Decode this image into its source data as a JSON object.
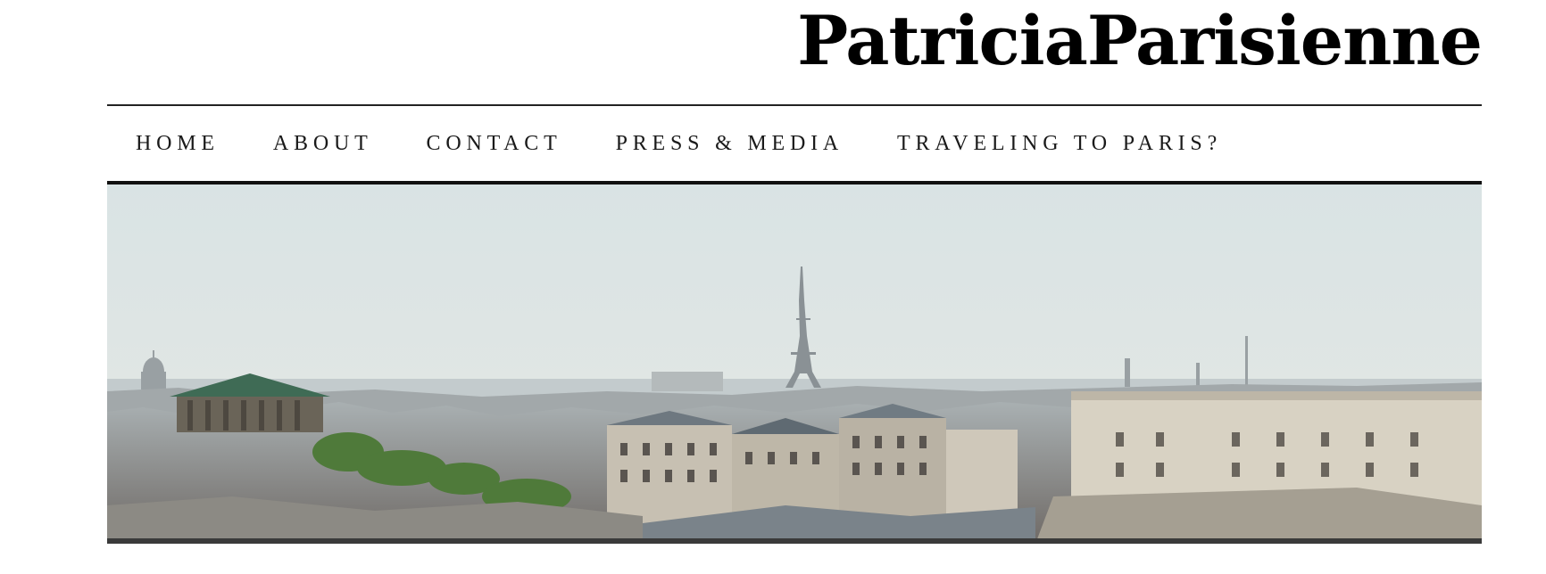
{
  "site": {
    "title": "PatriciaParisienne"
  },
  "nav": {
    "items": [
      {
        "label": "HOME"
      },
      {
        "label": "ABOUT"
      },
      {
        "label": "CONTACT"
      },
      {
        "label": "PRESS & MEDIA"
      },
      {
        "label": "TRAVELING TO PARIS?"
      }
    ]
  },
  "banner": {
    "subject": "Paris skyline panorama with Eiffel Tower"
  },
  "colors": {
    "text": "#000000",
    "rule": "#222222",
    "sky": "#dfe6e6",
    "roof": "#7f8a93",
    "building": "#c9c2b4"
  }
}
